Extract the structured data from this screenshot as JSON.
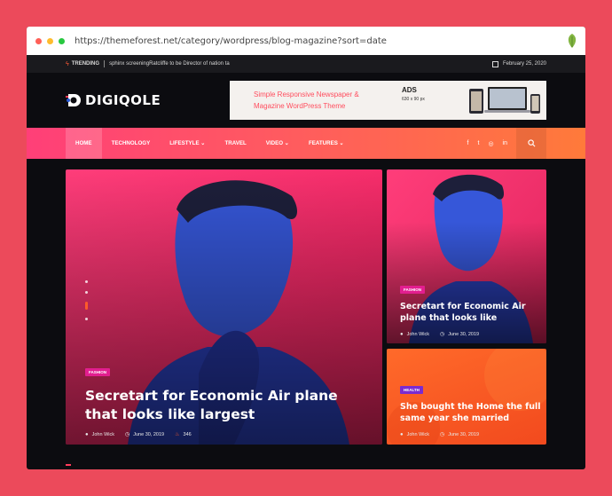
{
  "browser": {
    "url": "https://themeforest.net/category/wordpress/blog-magazine?sort=date"
  },
  "topbar": {
    "trending_label": "TRENDING",
    "trending_text": "sphinx screeningRatcliffe to be Director of nation ta",
    "date": "February 25, 2020"
  },
  "header": {
    "logo_text": "DIGIQOLE",
    "ad": {
      "line1": "Simple Responsive Newspaper &",
      "line2": "Magazine WordPress Theme",
      "label": "ADS",
      "size": "630 x 90 px"
    }
  },
  "nav": {
    "items": [
      {
        "label": "HOME"
      },
      {
        "label": "TECHNOLOGY"
      },
      {
        "label": "LIFESTYLE ⌄"
      },
      {
        "label": "TRAVEL"
      },
      {
        "label": "VIDEO ⌄"
      },
      {
        "label": "FEATURES ⌄"
      }
    ],
    "social": [
      "f",
      "t",
      "◎",
      "in"
    ]
  },
  "hero": {
    "category": "FASHION",
    "title": "Secretart for Economic Air plane that looks like largest",
    "author": "John Wick",
    "date": "June 30, 2019",
    "views": "346"
  },
  "cards": [
    {
      "category": "FASHION",
      "title": "Secretart for Economic Air plane that looks like",
      "author": "John Wick",
      "date": "June 30, 2019"
    },
    {
      "category": "HEALTH",
      "title": "She bought the Home the full same year she married",
      "author": "John Wick",
      "date": "June 30, 2019"
    }
  ],
  "colors": {
    "page_bg": "#ec4a5b",
    "nav_gradient_start": "#ff3f78",
    "nav_gradient_end": "#ff7a3a",
    "fashion_badge": "#e21e8f",
    "health_badge": "#7a2bd1",
    "orange_card": "#ff6a2a"
  }
}
